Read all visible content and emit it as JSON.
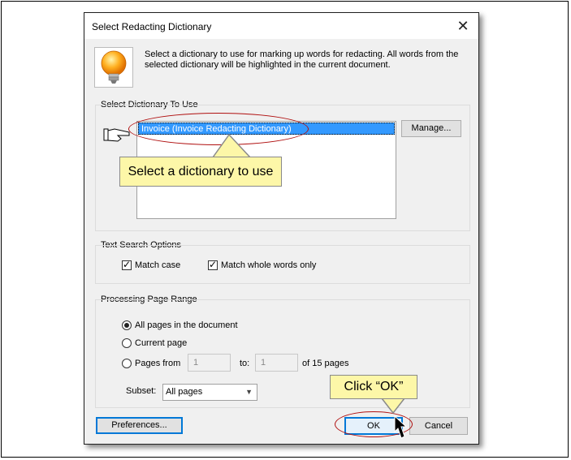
{
  "dialog": {
    "title": "Select Redacting Dictionary",
    "close_label": "✕",
    "description": "Select a dictionary to use for marking up words for redacting. All words from the selected dictionary will be highlighted in the current document."
  },
  "dictionary_group": {
    "label": "Select Dictionary To Use",
    "items": [
      "Invoice (Invoice Redacting Dictionary)"
    ],
    "manage_label": "Manage..."
  },
  "search_group": {
    "label": "Text Search Options",
    "match_case": "Match case",
    "match_whole": "Match whole words only"
  },
  "range_group": {
    "label": "Processing Page Range",
    "all_pages": "All pages in the document",
    "current_page": "Current page",
    "pages_from": "Pages from",
    "from_value": "1",
    "to_label": "to:",
    "to_value": "1",
    "of_pages": "of 15 pages",
    "subset_label": "Subset:",
    "subset_value": "All pages"
  },
  "buttons": {
    "preferences": "Preferences...",
    "ok": "OK",
    "cancel": "Cancel"
  },
  "callouts": {
    "dictionary": "Select a dictionary to use",
    "ok": "Click “OK”"
  },
  "colors": {
    "selection": "#3399ff",
    "annotation_ellipse": "#b01010",
    "callout_fill": "#fdf7a8"
  }
}
